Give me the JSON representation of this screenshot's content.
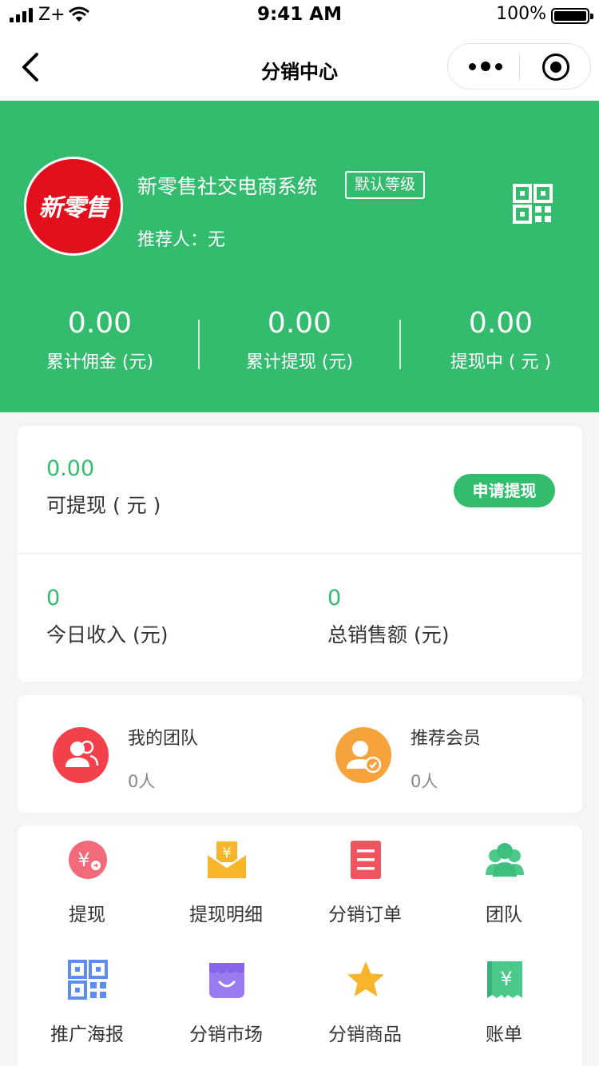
{
  "status_bar": {
    "carrier": "Z+",
    "time": "9:41 AM",
    "battery": "100%"
  },
  "nav": {
    "title": "分销中心"
  },
  "profile": {
    "avatar_logo": "新零售",
    "shop_name": "新零售社交电商系统",
    "level": "默认等级",
    "referrer": "推荐人：无"
  },
  "stats": [
    {
      "value": "0.00",
      "label": "累计佣金 (元)"
    },
    {
      "value": "0.00",
      "label": "累计提现 (元)"
    },
    {
      "value": "0.00",
      "label": "提现中 ( 元 )"
    }
  ],
  "withdraw": {
    "available_value": "0.00",
    "available_label": "可提现 ( 元 )",
    "apply_button": "申请提现",
    "today_value": "0",
    "today_label": "今日收入 (元)",
    "total_value": "0",
    "total_label": "总销售额 (元)"
  },
  "team": [
    {
      "title": "我的团队",
      "count": "0人"
    },
    {
      "title": "推荐会员",
      "count": "0人"
    }
  ],
  "menu": [
    {
      "label": "提现",
      "icon": "yuan-coin-icon"
    },
    {
      "label": "提现明细",
      "icon": "envelope-yuan-icon"
    },
    {
      "label": "分销订单",
      "icon": "order-list-icon"
    },
    {
      "label": "团队",
      "icon": "team-people-icon"
    },
    {
      "label": "推广海报",
      "icon": "qr-poster-icon"
    },
    {
      "label": "分销市场",
      "icon": "market-store-icon"
    },
    {
      "label": "分销商品",
      "icon": "star-icon"
    },
    {
      "label": "账单",
      "icon": "bill-yuan-icon"
    }
  ],
  "colors": {
    "primary": "#33bb6e",
    "team_red": "#f2414a",
    "member_orange": "#f7a33c"
  }
}
